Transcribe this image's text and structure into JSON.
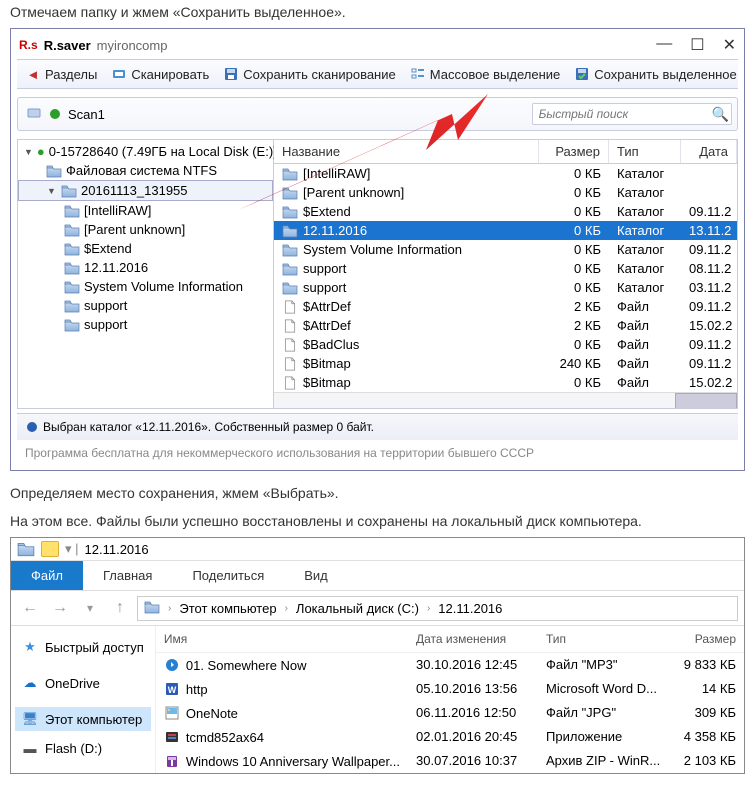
{
  "article": {
    "line1": "Отмечаем папку и жмем «Сохранить выделенное».",
    "line2": "Определяем место сохранения, жмем «Выбрать».",
    "line3": "На этом все. Файлы были успешно восстановлены и сохранены на локальный диск компьютера."
  },
  "rsaver": {
    "app_icon_text": "R.s",
    "title_app": "R.saver",
    "title_sub": "myironcomp",
    "toolbar": {
      "partitions": "Разделы",
      "scan": "Сканировать",
      "save_scan": "Сохранить сканирование",
      "mass_select": "Массовое выделение",
      "save_selected": "Сохранить выделенное"
    },
    "scan_label": "Scan1",
    "search_placeholder": "Быстрый поиск",
    "tree": {
      "root": "0-15728640 (7.49ГБ на Local Disk (E:))",
      "fs": "Файловая система NTFS",
      "session": "20161113_131955",
      "items": [
        "[IntelliRAW]",
        "[Parent unknown]",
        "$Extend",
        "12.11.2016",
        "System Volume Information",
        "support",
        "support"
      ]
    },
    "list": {
      "headers": {
        "name": "Название",
        "size": "Размер",
        "type": "Тип",
        "date": "Дата"
      },
      "rows": [
        {
          "name": "[IntelliRAW]",
          "size": "0 КБ",
          "type": "Каталог",
          "date": ""
        },
        {
          "name": "[Parent unknown]",
          "size": "0 КБ",
          "type": "Каталог",
          "date": ""
        },
        {
          "name": "$Extend",
          "size": "0 КБ",
          "type": "Каталог",
          "date": "09.11.2"
        },
        {
          "name": "12.11.2016",
          "size": "0 КБ",
          "type": "Каталог",
          "date": "13.11.2",
          "selected": true
        },
        {
          "name": "System Volume Information",
          "size": "0 КБ",
          "type": "Каталог",
          "date": "09.11.2"
        },
        {
          "name": "support",
          "size": "0 КБ",
          "type": "Каталог",
          "date": "08.11.2"
        },
        {
          "name": "support",
          "size": "0 КБ",
          "type": "Каталог",
          "date": "03.11.2"
        },
        {
          "name": "$AttrDef",
          "size": "2 КБ",
          "type": "Файл",
          "date": "09.11.2",
          "file": true
        },
        {
          "name": "$AttrDef",
          "size": "2 КБ",
          "type": "Файл",
          "date": "15.02.2",
          "file": true
        },
        {
          "name": "$BadClus",
          "size": "0 КБ",
          "type": "Файл",
          "date": "09.11.2",
          "file": true
        },
        {
          "name": "$Bitmap",
          "size": "240 КБ",
          "type": "Файл",
          "date": "09.11.2",
          "file": true
        },
        {
          "name": "$Bitmap",
          "size": "0 КБ",
          "type": "Файл",
          "date": "15.02.2",
          "file": true
        }
      ]
    },
    "status": "Выбран каталог «12.11.2016». Собственный размер 0 байт.",
    "footer": "Программа бесплатна для некоммерческого использования на территории бывшего СССР"
  },
  "explorer": {
    "title": "12.11.2016",
    "tabs": {
      "file": "Файл",
      "home": "Главная",
      "share": "Поделиться",
      "view": "Вид"
    },
    "breadcrumb": [
      "Этот компьютер",
      "Локальный диск (C:)",
      "12.11.2016"
    ],
    "nav": {
      "quick": "Быстрый доступ",
      "onedrive": "OneDrive",
      "thispc": "Этот компьютер",
      "flash": "Flash (D:)"
    },
    "list": {
      "headers": {
        "name": "Имя",
        "date": "Дата изменения",
        "type": "Тип",
        "size": "Размер"
      },
      "rows": [
        {
          "name": "01. Somewhere Now",
          "date": "30.10.2016 12:45",
          "type": "Файл \"MP3\"",
          "size": "9 833 КБ",
          "icon": "mp3"
        },
        {
          "name": "http",
          "date": "05.10.2016 13:56",
          "type": "Microsoft Word D...",
          "size": "14 КБ",
          "icon": "word"
        },
        {
          "name": "OneNote",
          "date": "06.11.2016 12:50",
          "type": "Файл \"JPG\"",
          "size": "309 КБ",
          "icon": "jpg"
        },
        {
          "name": "tcmd852ax64",
          "date": "02.01.2016 20:45",
          "type": "Приложение",
          "size": "4 358 КБ",
          "icon": "exe"
        },
        {
          "name": "Windows 10 Anniversary Wallpaper...",
          "date": "30.07.2016 10:37",
          "type": "Архив ZIP - WinR...",
          "size": "2 103 КБ",
          "icon": "zip"
        }
      ]
    }
  }
}
